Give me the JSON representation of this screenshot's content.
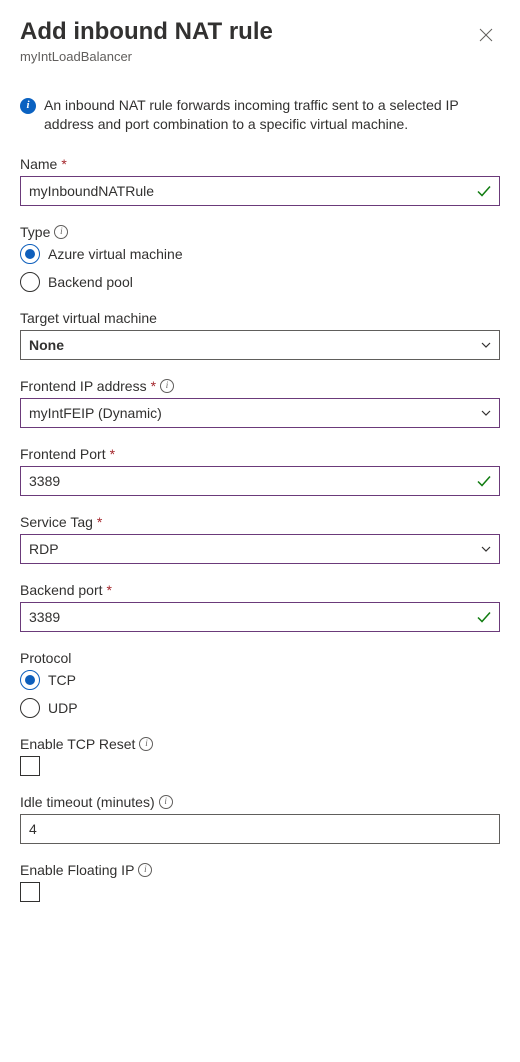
{
  "header": {
    "title": "Add inbound NAT rule",
    "subtitle": "myIntLoadBalancer"
  },
  "info": {
    "text": "An inbound NAT rule forwards incoming traffic sent to a selected IP address and port combination to a specific virtual machine."
  },
  "fields": {
    "name": {
      "label": "Name",
      "value": "myInboundNATRule"
    },
    "type": {
      "label": "Type",
      "options": {
        "avm": "Azure virtual machine",
        "pool": "Backend pool"
      },
      "selected": "avm"
    },
    "targetVm": {
      "label": "Target virtual machine",
      "value": "None"
    },
    "frontendIp": {
      "label": "Frontend IP address",
      "value": "myIntFEIP (Dynamic)"
    },
    "frontendPort": {
      "label": "Frontend Port",
      "value": "3389"
    },
    "serviceTag": {
      "label": "Service Tag",
      "value": "RDP"
    },
    "backendPort": {
      "label": "Backend port",
      "value": "3389"
    },
    "protocol": {
      "label": "Protocol",
      "options": {
        "tcp": "TCP",
        "udp": "UDP"
      },
      "selected": "tcp"
    },
    "tcpReset": {
      "label": "Enable TCP Reset",
      "checked": false
    },
    "idleTimeout": {
      "label": "Idle timeout (minutes)",
      "value": "4"
    },
    "floatingIp": {
      "label": "Enable Floating IP",
      "checked": false
    }
  },
  "requiredMark": "*",
  "infoGlyph": "i"
}
